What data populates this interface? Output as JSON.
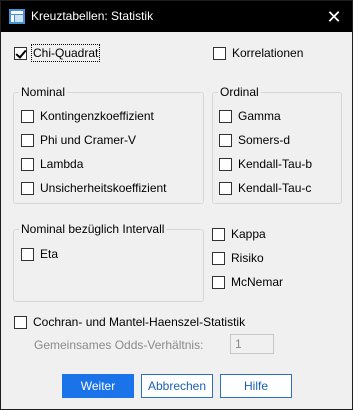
{
  "window": {
    "title": "Kreuztabellen: Statistik",
    "close_glyph": "✕"
  },
  "top": {
    "chi_quadrat": {
      "label": "Chi-Quadrat",
      "checked": true
    },
    "korrelationen": {
      "label": "Korrelationen",
      "checked": false
    }
  },
  "nominal": {
    "title": "Nominal",
    "items": [
      {
        "label": "Kontingenzkoeffizient",
        "checked": false
      },
      {
        "label": "Phi und Cramer-V",
        "checked": false
      },
      {
        "label": "Lambda",
        "checked": false
      },
      {
        "label": "Unsicherheitskoeffizient",
        "checked": false
      }
    ]
  },
  "ordinal": {
    "title": "Ordinal",
    "items": [
      {
        "label": "Gamma",
        "checked": false
      },
      {
        "label": "Somers-d",
        "checked": false
      },
      {
        "label": "Kendall-Tau-b",
        "checked": false
      },
      {
        "label": "Kendall-Tau-c",
        "checked": false
      }
    ]
  },
  "interval": {
    "title": "Nominal bezüglich Intervall",
    "eta": {
      "label": "Eta",
      "checked": false
    }
  },
  "other": {
    "items": [
      {
        "label": "Kappa",
        "checked": false
      },
      {
        "label": "Risiko",
        "checked": false
      },
      {
        "label": "McNemar",
        "checked": false
      }
    ]
  },
  "cmh": {
    "label": "Cochran- und Mantel-Haenszel-Statistik",
    "checked": false,
    "odds_label": "Gemeinsames Odds-Verhältnis:",
    "odds_value": "1"
  },
  "buttons": {
    "ok": "Weiter",
    "cancel": "Abbrechen",
    "help": "Hilfe"
  },
  "colors": {
    "accent": "#1a73e8",
    "titlebar": "#000000",
    "dialog_bg": "#f0f0f0"
  },
  "icons": {
    "app": "spss-app-icon",
    "close": "close-icon"
  }
}
